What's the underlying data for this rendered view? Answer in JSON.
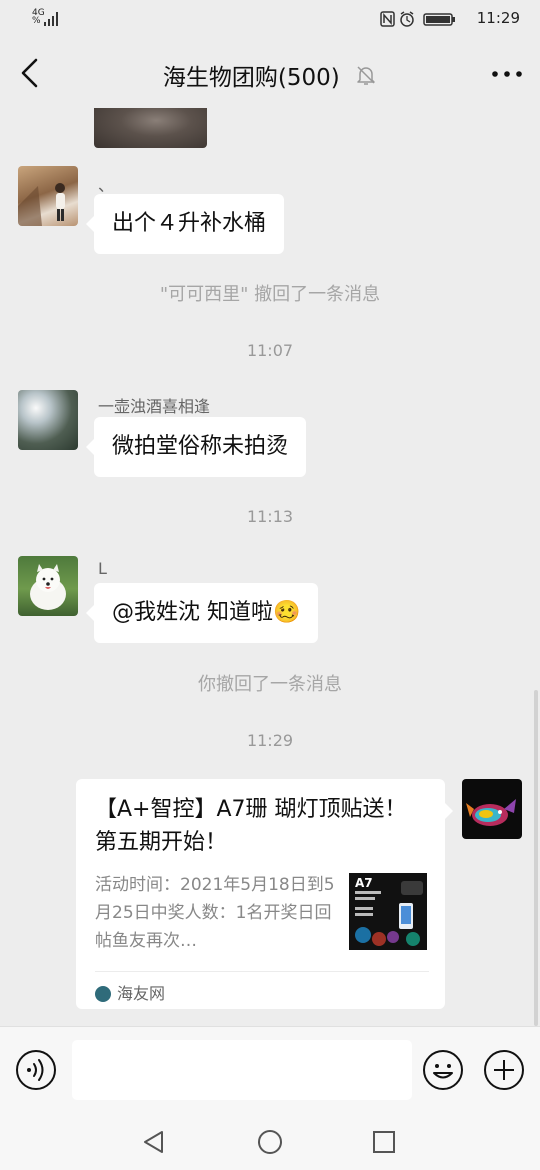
{
  "status_bar": {
    "network": "4G",
    "network_sub": "%",
    "time": "11:29"
  },
  "header": {
    "title": "海生物团购(500)",
    "icons": {
      "back": "chevron-left-icon",
      "mute": "bell-off-icon",
      "more": "more-dots-icon"
    }
  },
  "messages": [
    {
      "nick": "、",
      "text": "出个４升补水桶"
    },
    {
      "system": "\"可可西里\" 撤回了一条消息"
    },
    {
      "time": "11:07"
    },
    {
      "nick": "一壶浊酒喜相逢",
      "text": "微拍堂俗称未拍烫"
    },
    {
      "time": "11:13"
    },
    {
      "nick": "L",
      "text": "@我姓沈  知道啦🥴"
    },
    {
      "system": "你撤回了一条消息"
    },
    {
      "time": "11:29"
    }
  ],
  "link_card": {
    "title": "【A+智控】A7珊 瑚灯顶贴送！第五期开始！",
    "description": "活动时间：2021年5月18日到5月25日中奖人数：1名开奖日回帖鱼友再次…",
    "thumb_label": "A7",
    "source": "海友网"
  },
  "input_bar": {
    "placeholder": "",
    "icons": {
      "voice": "voice-icon",
      "emoji": "emoji-icon",
      "plus": "plus-circle-icon"
    }
  },
  "nav_bar": {
    "icons": {
      "back": "nav-back-icon",
      "home": "nav-home-icon",
      "recent": "nav-recent-icon"
    }
  },
  "colors": {
    "chat_background": "#ededed",
    "bubble": "#ffffff",
    "system_text": "#a6a6a6"
  }
}
